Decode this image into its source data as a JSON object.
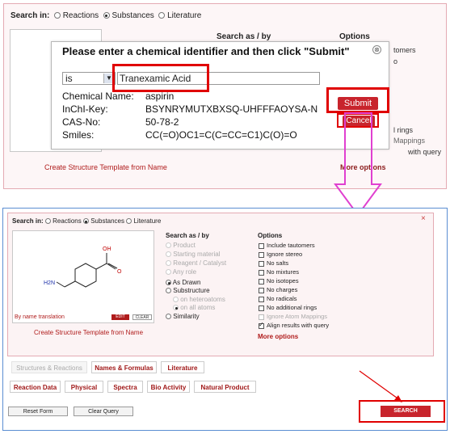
{
  "top": {
    "search_in_label": "Search in:",
    "radios": [
      "Reactions",
      "Substances",
      "Literature"
    ],
    "selected": "Substances",
    "search_as_label": "Search as / by",
    "options_label": "Options",
    "options_visible": [
      "tomers",
      "o",
      "l rings",
      "Mappings",
      "with query"
    ],
    "create_template": "Create Structure Template from Name",
    "more_options": "More options"
  },
  "dialog": {
    "title": "Please enter a chemical identifier and then click \"Submit\"",
    "close_glyph": "⊗",
    "operator_value": "is",
    "input_value": "Tranexamic Acid",
    "rows": [
      {
        "label": "Chemical Name:",
        "value": "aspirin"
      },
      {
        "label": "InChI-Key:",
        "value": "BSYNRYMUTXBXSQ-UHFFFAOYSA-N"
      },
      {
        "label": "CAS-No:",
        "value": "50-78-2"
      },
      {
        "label": "Smiles:",
        "value": "CC(=O)OC1=C(C=CC=C1)C(O)=O"
      }
    ],
    "submit_label": "Submit",
    "cancel_label": "Cancel"
  },
  "bottom": {
    "close_glyph": "×",
    "search_in_label": "Search in:",
    "radios": [
      "Reactions",
      "Substances",
      "Literature"
    ],
    "selected": "Substances",
    "structure": {
      "oh": "OH",
      "o": "O",
      "amine": "H2N"
    },
    "by_name": "By name translation",
    "edit_label": "EDIT",
    "clear_label": "CLEAR",
    "create_template": "Create Structure Template from Name",
    "search_as_label": "Search as / by",
    "roles": [
      "Product",
      "Starting material",
      "Reagent / Catalyst",
      "Any role"
    ],
    "modes": [
      "As Drawn",
      "Substructure",
      "on heteroatoms",
      "on all atoms",
      "Similarity"
    ],
    "options_label": "Options",
    "options": [
      {
        "label": "Include tautomers",
        "checked": false,
        "disabled": false
      },
      {
        "label": "Ignore stereo",
        "checked": false,
        "disabled": false
      },
      {
        "label": "No salts",
        "checked": false,
        "disabled": false
      },
      {
        "label": "No mixtures",
        "checked": false,
        "disabled": false
      },
      {
        "label": "No isotopes",
        "checked": false,
        "disabled": false
      },
      {
        "label": "No charges",
        "checked": false,
        "disabled": false
      },
      {
        "label": "No radicals",
        "checked": false,
        "disabled": false
      },
      {
        "label": "No additional rings",
        "checked": false,
        "disabled": false
      },
      {
        "label": "Ignore Atom Mappings",
        "checked": false,
        "disabled": true
      },
      {
        "label": "Align results with query",
        "checked": true,
        "disabled": false
      }
    ],
    "more_options": "More options",
    "tabs_row1": [
      "Structures & Reactions",
      "Names & Formulas",
      "Literature"
    ],
    "tabs_row2": [
      "Reaction Data",
      "Physical",
      "Spectra",
      "Bio Activity",
      "Natural Product"
    ],
    "reset_label": "Reset Form",
    "clear_query_label": "Clear Query",
    "search_label": "SEARCH"
  },
  "colors": {
    "accent_red": "#c8242c",
    "annotation_red": "#e00000",
    "arrow_pink": "#e040d0",
    "frame_blue": "#5b8ed2"
  }
}
